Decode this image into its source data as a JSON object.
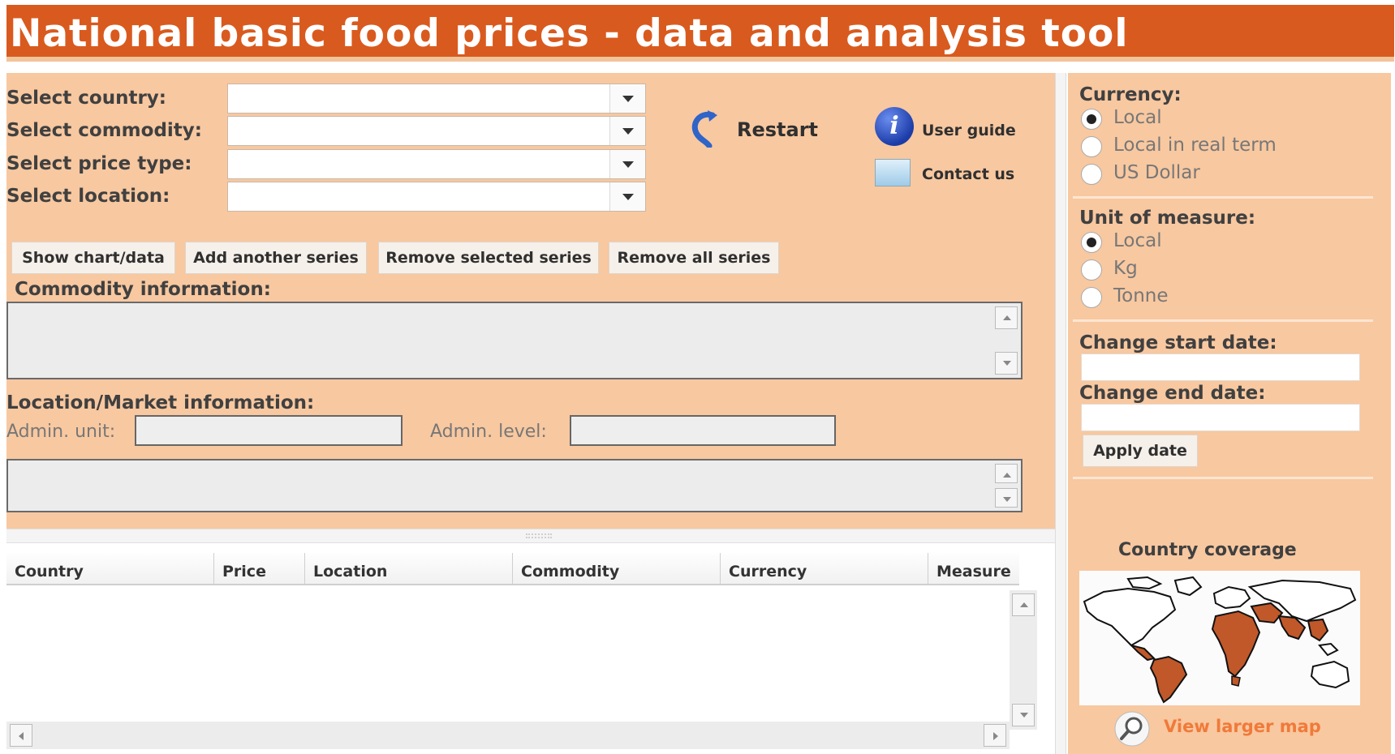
{
  "app": {
    "title": "National basic food prices - data and analysis tool"
  },
  "selectors": {
    "country_label": "Select country:",
    "commodity_label": "Select commodity:",
    "price_type_label": "Select price type:",
    "location_label": "Select location:"
  },
  "tools": {
    "restart": "Restart",
    "user_guide": "User guide",
    "contact_us": "Contact us"
  },
  "actions": {
    "show_chart": "Show chart/data",
    "add_series": "Add another series",
    "remove_selected": "Remove selected series",
    "remove_all": "Remove all series"
  },
  "info": {
    "commodity_info_label": "Commodity information:",
    "location_info_label": "Location/Market information:",
    "admin_unit_label": "Admin. unit:",
    "admin_level_label": "Admin. level:"
  },
  "table": {
    "columns": [
      "Country",
      "Price",
      "Location",
      "Commodity",
      "Currency",
      "Measure"
    ]
  },
  "settings": {
    "currency_label": "Currency:",
    "currency_options": [
      "Local",
      "Local in real term",
      "US Dollar"
    ],
    "currency_selected": "Local",
    "unit_label": "Unit of measure:",
    "unit_options": [
      "Local",
      "Kg",
      "Tonne"
    ],
    "unit_selected": "Local",
    "start_date_label": "Change start date:",
    "end_date_label": "Change end date:",
    "apply_date": "Apply date"
  },
  "coverage": {
    "title": "Country coverage",
    "larger_map": "View larger map"
  },
  "colors": {
    "title_bar": "#d95a1e",
    "panel": "#f8c8a0",
    "map_highlight": "#c0582a",
    "link": "#f07a3a"
  }
}
